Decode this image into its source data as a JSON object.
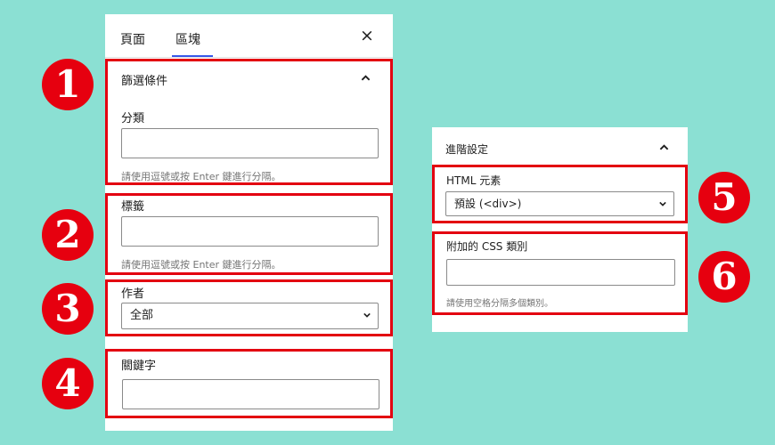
{
  "left_panel": {
    "tabs": [
      {
        "label": "頁面",
        "active": false
      },
      {
        "label": "區塊",
        "active": true
      }
    ],
    "close_label": "×",
    "filter_section": {
      "title": "篩選條件",
      "category_label": "分類",
      "category_value": "",
      "category_help": "請使用逗號或按 Enter 鍵進行分隔。",
      "tags_label": "標籤",
      "tags_value": "",
      "tags_help": "請使用逗號或按 Enter 鍵進行分隔。",
      "author_label": "作者",
      "author_selected": "全部",
      "keyword_label": "關鍵字",
      "keyword_value": ""
    }
  },
  "right_panel": {
    "title": "進階設定",
    "html_element_label": "HTML 元素",
    "html_element_selected": "預設 (<div>)",
    "css_class_label": "附加的 CSS 類別",
    "css_class_value": "",
    "css_class_help": "請使用空格分隔多個類別。"
  },
  "badges": [
    "1",
    "2",
    "3",
    "4",
    "5",
    "6"
  ],
  "colors": {
    "background": "#8be0d3",
    "highlight": "#e30010",
    "accent": "#3858e9",
    "badge": "#e6000f"
  }
}
